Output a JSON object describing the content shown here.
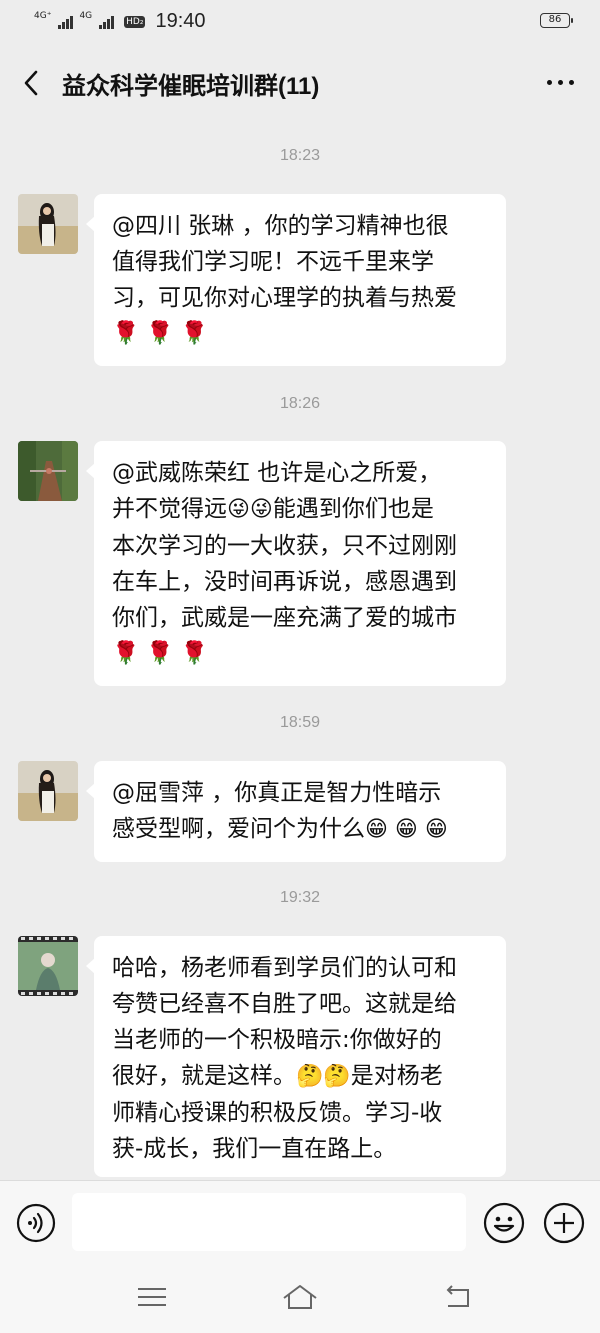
{
  "status_bar": {
    "net1": "4G⁺",
    "net2": "4G",
    "hd": "HD₂",
    "time": "19:40",
    "battery": "86"
  },
  "header": {
    "title": "益众科学催眠培训群(11)"
  },
  "messages": [
    {
      "timestamp": "18:23",
      "line1": "@四川  张琳 ，你的学习精神也很",
      "line2": "值得我们学习呢！不远千里来学",
      "line3": "习，可见你对心理学的执着与热爱",
      "emoji": "🌹 🌹 🌹"
    },
    {
      "timestamp": "18:26",
      "line1": "@武威陈荣红  也许是心之所爱，",
      "line2a": "并不觉得远",
      "line2_emoji": "😜😜",
      "line2b": "能遇到你们也是",
      "line3": "本次学习的一大收获，只不过刚刚",
      "line4": "在车上，没时间再诉说，感恩遇到",
      "line5": "你们，武威是一座充满了爱的城市",
      "emoji": "🌹 🌹 🌹"
    },
    {
      "timestamp": "18:59",
      "line1": "@屈雪萍 ，你真正是智力性暗示",
      "line2": "感受型啊，爱问个为什么",
      "emoji": "😁 😁 😁"
    },
    {
      "timestamp": "19:32",
      "line1": "哈哈，杨老师看到学员们的认可和",
      "line2": "夸赞已经喜不自胜了吧。这就是给",
      "line3": "当老师的一个积极暗示:你做好的",
      "line4a": "很好，就是这样。",
      "line4_emoji": "🤔🤔",
      "line4b": "是对杨老",
      "line5": "师精心授课的积极反馈。学习-收",
      "line6": "获-成长，我们一直在路上。"
    }
  ],
  "icons": {
    "back": "chevron-left-icon",
    "more": "more-dots-icon",
    "voice": "voice-icon",
    "emoji": "emoji-icon",
    "plus": "plus-icon"
  },
  "colors": {
    "background": "#ededed",
    "bubble": "#ffffff",
    "timestamp": "#9a9a9a"
  }
}
